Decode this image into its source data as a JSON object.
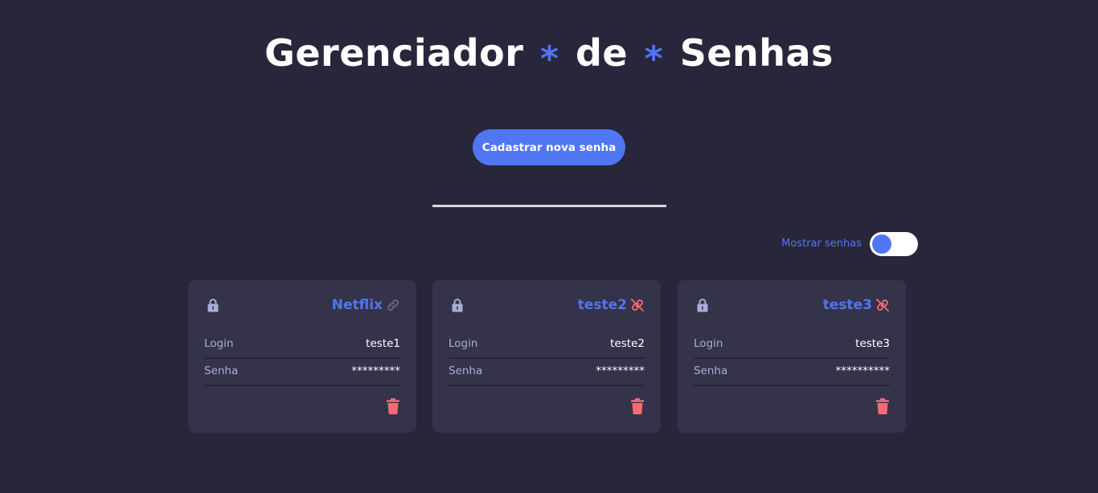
{
  "header": {
    "title_part1": "Gerenciador",
    "separator": "*",
    "title_part2": "de",
    "title_part3": "Senhas"
  },
  "actions": {
    "register_label": "Cadastrar nova senha"
  },
  "toggle": {
    "label": "Mostrar senhas",
    "checked": false
  },
  "labels": {
    "login": "Login",
    "senha": "Senha"
  },
  "cards": [
    {
      "service": "Netflix",
      "login": "teste1",
      "password_mask": "*********",
      "link_icon": "link-icon",
      "link_state": "active"
    },
    {
      "service": "teste2",
      "login": "teste2",
      "password_mask": "*********",
      "link_icon": "broken-link-icon",
      "link_state": "none"
    },
    {
      "service": "teste3",
      "login": "teste3",
      "password_mask": "**********",
      "link_icon": "broken-link-icon",
      "link_state": "none"
    }
  ],
  "colors": {
    "background": "#27263a",
    "card": "#34334a",
    "accent": "#5176f4",
    "danger": "#f46b73",
    "label": "#a7aed6"
  }
}
